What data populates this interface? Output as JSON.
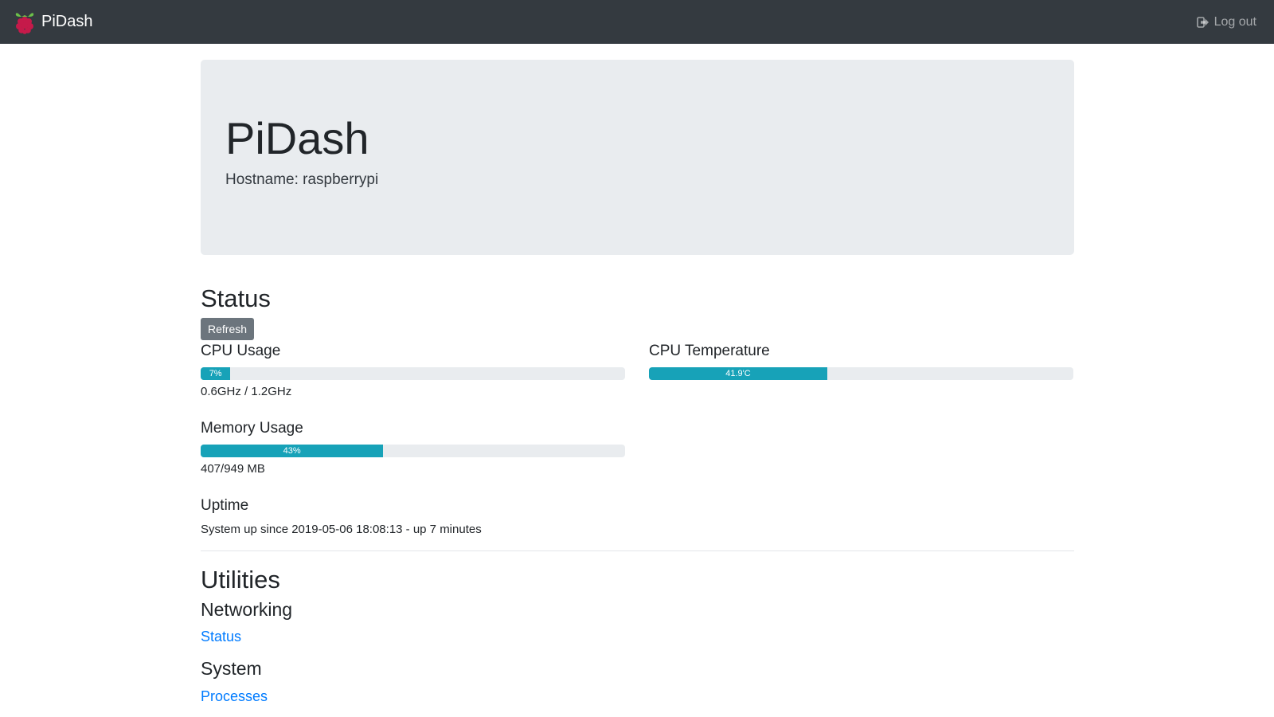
{
  "navbar": {
    "brand": "PiDash",
    "logout_label": "Log out"
  },
  "jumbotron": {
    "title": "PiDash",
    "hostname": "Hostname: raspberrypi"
  },
  "status": {
    "title": "Status",
    "refresh_label": "Refresh",
    "cpu_usage": {
      "label": "CPU Usage",
      "percent": 7,
      "bar_text": "7%",
      "detail": "0.6GHz / 1.2GHz"
    },
    "cpu_temperature": {
      "label": "CPU Temperature",
      "percent": 42,
      "bar_text": "41.9'C"
    },
    "memory_usage": {
      "label": "Memory Usage",
      "percent": 43,
      "bar_text": "43%",
      "detail": "407/949 MB"
    },
    "uptime": {
      "label": "Uptime",
      "text": "System up since 2019-05-06 18:08:13 - up 7 minutes"
    }
  },
  "utilities": {
    "title": "Utilities",
    "networking": {
      "title": "Networking",
      "link": "Status"
    },
    "system": {
      "title": "System",
      "link": "Processes"
    }
  },
  "colors": {
    "navbar": "#343a40",
    "progress_fill": "#17a2b8",
    "progress_track": "#e9ecef",
    "link": "#007bff",
    "button": "#6c757d"
  }
}
